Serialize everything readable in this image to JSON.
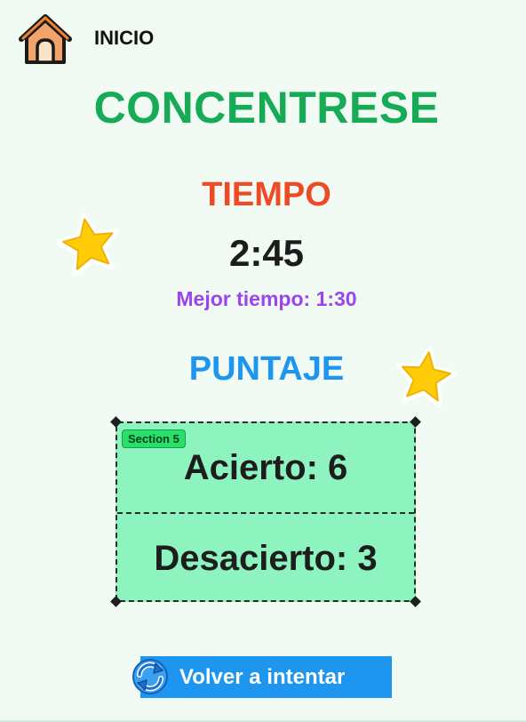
{
  "header": {
    "home_icon": "house-icon",
    "home_label": "INICIO"
  },
  "game": {
    "title": "CONCENTRESE",
    "time_label": "TIEMPO",
    "time_value": "2:45",
    "best_time": "Mejor tiempo: 1:30",
    "score_label": "PUNTAJE"
  },
  "score_panel": {
    "section_tag": "Section 5",
    "hits": "Acierto:  6",
    "misses": "Desacierto:  3"
  },
  "actions": {
    "retry_label": "Volver a intentar",
    "retry_icon": "refresh-icon"
  },
  "decorations": {
    "star_icon": "star-icon"
  },
  "colors": {
    "background": "#f1faf3",
    "title": "#18ab57",
    "time_label": "#ee4a25",
    "best_time": "#9b45f2",
    "score_label": "#1e96f0",
    "score_box": "#8df3bf",
    "button": "#1e96f0"
  }
}
